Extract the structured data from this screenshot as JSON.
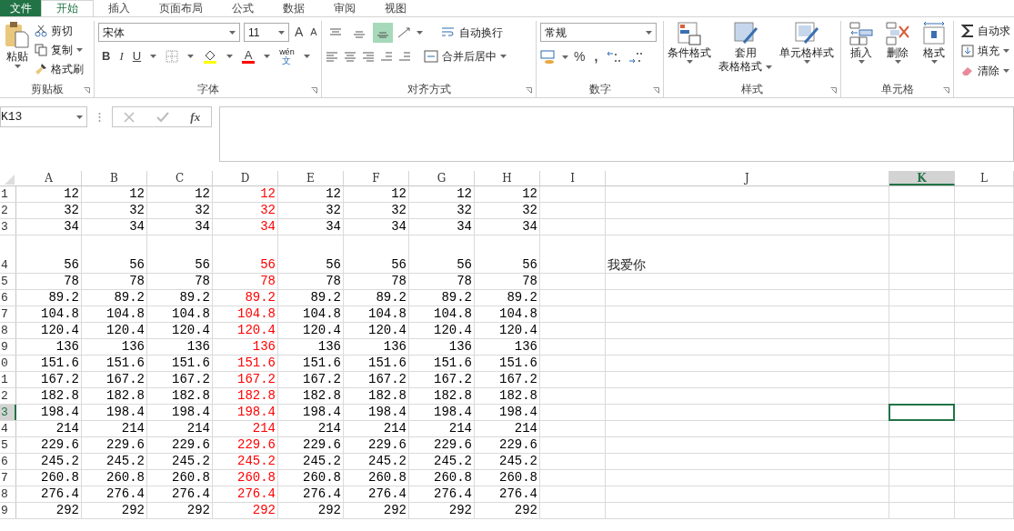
{
  "tabs": [
    {
      "label": "文件",
      "selected": false,
      "kind": "file"
    },
    {
      "label": "开始",
      "selected": true,
      "kind": "tab"
    },
    {
      "label": "插入",
      "selected": false,
      "kind": "tab"
    },
    {
      "label": "页面布局",
      "selected": false,
      "kind": "tab"
    },
    {
      "label": "公式",
      "selected": false,
      "kind": "tab"
    },
    {
      "label": "数据",
      "selected": false,
      "kind": "tab"
    },
    {
      "label": "审阅",
      "selected": false,
      "kind": "tab"
    },
    {
      "label": "视图",
      "selected": false,
      "kind": "tab"
    }
  ],
  "clipboard": {
    "paste": "粘贴",
    "cut": "剪切",
    "copy": "复制",
    "format_painter": "格式刷",
    "label": "剪贴板"
  },
  "font": {
    "name": "宋体",
    "size": "11",
    "grow": "A",
    "shrink": "A",
    "bold": "B",
    "italic": "I",
    "underline": "U",
    "font_color": "A",
    "phonetic_top": "wén",
    "phonetic_char": "文",
    "label": "字体"
  },
  "alignment": {
    "vertical": [
      {
        "selected": false
      },
      {
        "selected": false
      },
      {
        "selected": true
      }
    ],
    "wrap": "自动换行",
    "merge": "合并后居中",
    "label": "对齐方式"
  },
  "number": {
    "format": "常规",
    "percent": "%",
    "comma": ",",
    "label": "数字"
  },
  "styles": {
    "conditional": "条件格式",
    "table_line1": "套用",
    "table_line2": "表格格式",
    "cell_styles": "单元格样式",
    "label": "样式"
  },
  "cells_group": {
    "insert": "插入",
    "delete": "删除",
    "format": "格式",
    "label": "单元格"
  },
  "editing": {
    "autosum": "自动求",
    "fill": "填充",
    "clear": "清除"
  },
  "formula_bar": {
    "name_box": "K13",
    "fx": "fx"
  },
  "columns": [
    {
      "label": "A",
      "selected": false,
      "color": "#000000"
    },
    {
      "label": "B",
      "selected": false,
      "color": "#000000"
    },
    {
      "label": "C",
      "selected": false,
      "color": "#000000"
    },
    {
      "label": "D",
      "selected": false,
      "color": "#ff0000"
    },
    {
      "label": "E",
      "selected": false,
      "color": "#000000"
    },
    {
      "label": "F",
      "selected": false,
      "color": "#000000"
    },
    {
      "label": "G",
      "selected": false,
      "color": "#000000"
    },
    {
      "label": "H",
      "selected": false,
      "color": "#000000"
    },
    {
      "label": "I",
      "selected": false
    },
    {
      "label": "J",
      "selected": false,
      "wide": true
    },
    {
      "label": "K",
      "selected": true
    },
    {
      "label": "L",
      "selected": false
    }
  ],
  "rows": [
    {
      "header": "1",
      "selected": false,
      "values": [
        "12",
        "12",
        "12",
        "12",
        "12",
        "12",
        "12",
        "12"
      ]
    },
    {
      "header": "2",
      "selected": false,
      "values": [
        "32",
        "32",
        "32",
        "32",
        "32",
        "32",
        "32",
        "32"
      ]
    },
    {
      "header": "3",
      "selected": false,
      "values": [
        "34",
        "34",
        "34",
        "34",
        "34",
        "34",
        "34",
        "34"
      ]
    },
    {
      "header": "4",
      "selected": false,
      "tall": true,
      "values": [
        "56",
        "56",
        "56",
        "56",
        "56",
        "56",
        "56",
        "56"
      ],
      "note": "我爱你"
    },
    {
      "header": "5",
      "selected": false,
      "values": [
        "78",
        "78",
        "78",
        "78",
        "78",
        "78",
        "78",
        "78"
      ]
    },
    {
      "header": "6",
      "selected": false,
      "values": [
        "89.2",
        "89.2",
        "89.2",
        "89.2",
        "89.2",
        "89.2",
        "89.2",
        "89.2"
      ]
    },
    {
      "header": "7",
      "selected": false,
      "values": [
        "104.8",
        "104.8",
        "104.8",
        "104.8",
        "104.8",
        "104.8",
        "104.8",
        "104.8"
      ]
    },
    {
      "header": "8",
      "selected": false,
      "values": [
        "120.4",
        "120.4",
        "120.4",
        "120.4",
        "120.4",
        "120.4",
        "120.4",
        "120.4"
      ]
    },
    {
      "header": "9",
      "selected": false,
      "values": [
        "136",
        "136",
        "136",
        "136",
        "136",
        "136",
        "136",
        "136"
      ]
    },
    {
      "header": "0",
      "selected": false,
      "values": [
        "151.6",
        "151.6",
        "151.6",
        "151.6",
        "151.6",
        "151.6",
        "151.6",
        "151.6"
      ]
    },
    {
      "header": "1",
      "selected": false,
      "values": [
        "167.2",
        "167.2",
        "167.2",
        "167.2",
        "167.2",
        "167.2",
        "167.2",
        "167.2"
      ]
    },
    {
      "header": "2",
      "selected": false,
      "values": [
        "182.8",
        "182.8",
        "182.8",
        "182.8",
        "182.8",
        "182.8",
        "182.8",
        "182.8"
      ]
    },
    {
      "header": "3",
      "selected": true,
      "values": [
        "198.4",
        "198.4",
        "198.4",
        "198.4",
        "198.4",
        "198.4",
        "198.4",
        "198.4"
      ]
    },
    {
      "header": "4",
      "selected": false,
      "values": [
        "214",
        "214",
        "214",
        "214",
        "214",
        "214",
        "214",
        "214"
      ]
    },
    {
      "header": "5",
      "selected": false,
      "values": [
        "229.6",
        "229.6",
        "229.6",
        "229.6",
        "229.6",
        "229.6",
        "229.6",
        "229.6"
      ]
    },
    {
      "header": "6",
      "selected": false,
      "values": [
        "245.2",
        "245.2",
        "245.2",
        "245.2",
        "245.2",
        "245.2",
        "245.2",
        "245.2"
      ]
    },
    {
      "header": "7",
      "selected": false,
      "values": [
        "260.8",
        "260.8",
        "260.8",
        "260.8",
        "260.8",
        "260.8",
        "260.8",
        "260.8"
      ]
    },
    {
      "header": "8",
      "selected": false,
      "values": [
        "276.4",
        "276.4",
        "276.4",
        "276.4",
        "276.4",
        "276.4",
        "276.4",
        "276.4"
      ]
    },
    {
      "header": "9",
      "selected": false,
      "values": [
        "292",
        "292",
        "292",
        "292",
        "292",
        "292",
        "292",
        "292"
      ]
    }
  ]
}
